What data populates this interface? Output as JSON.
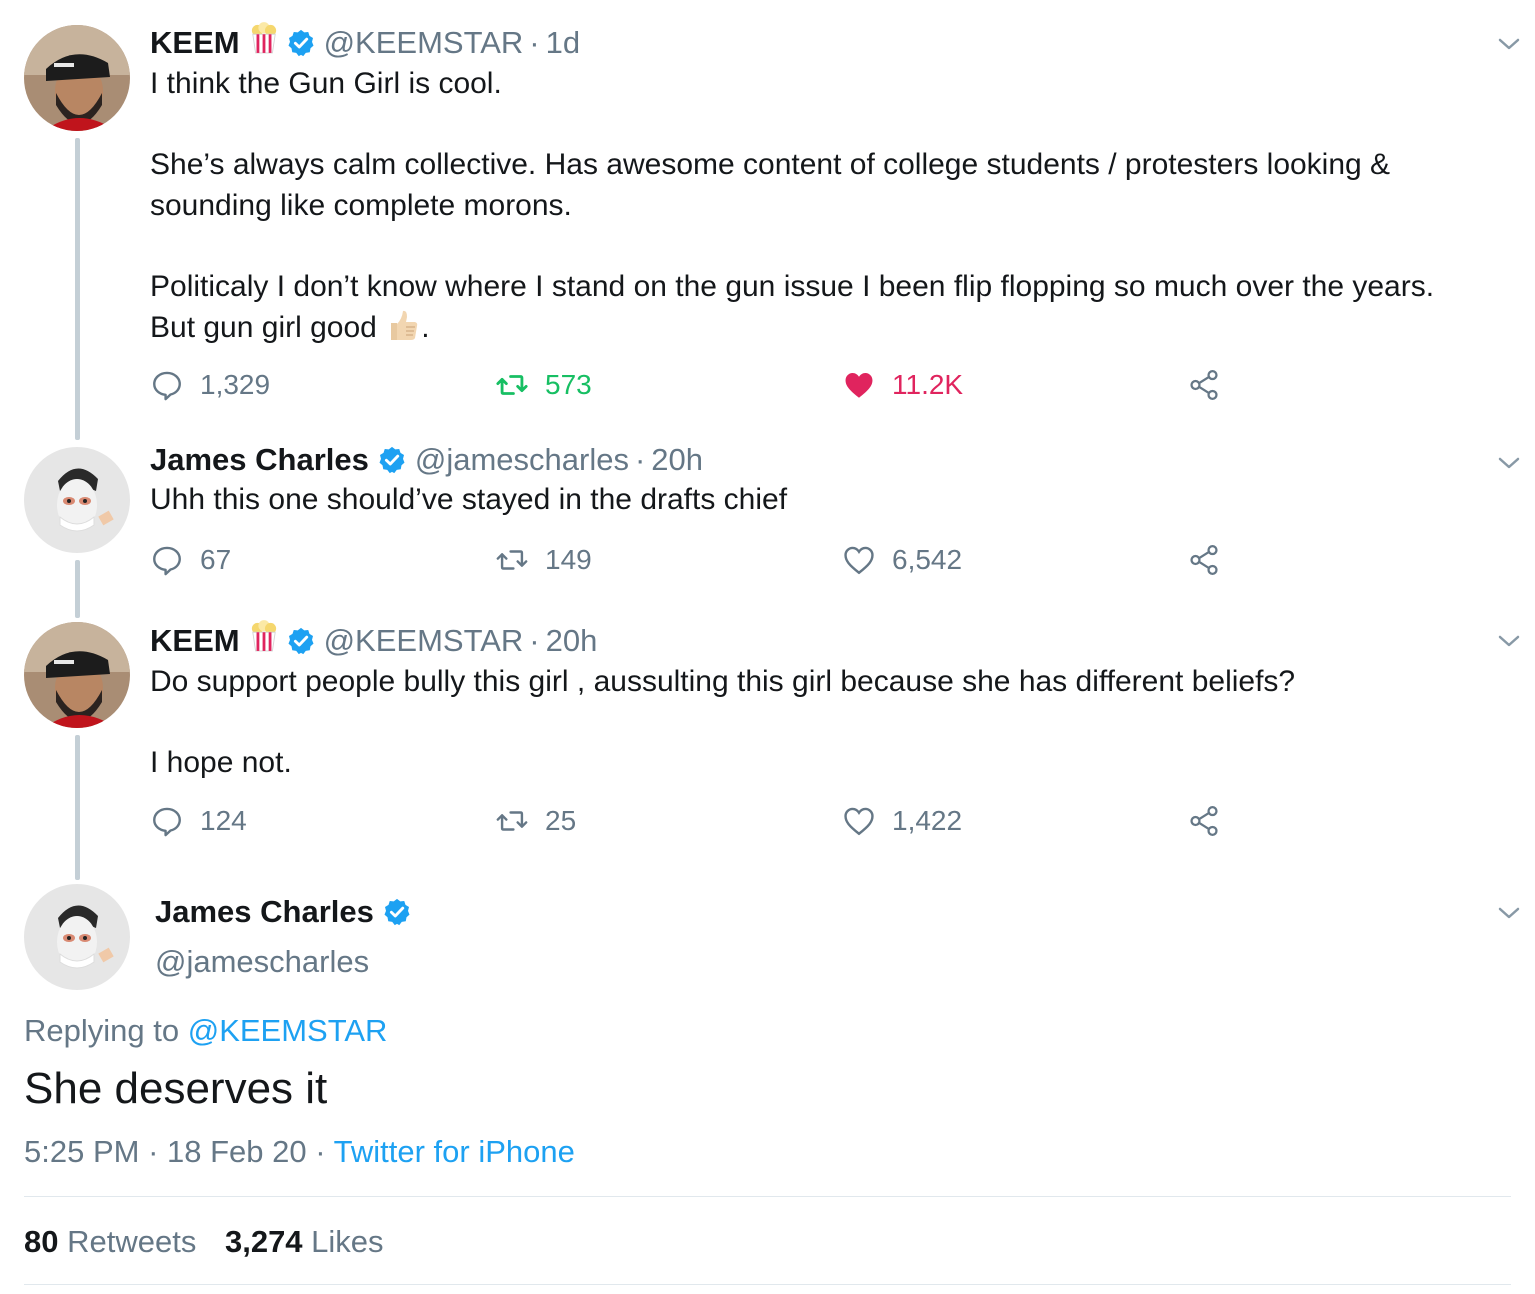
{
  "tweets": [
    {
      "name": "KEEM",
      "handle": "@KEEMSTAR",
      "time": "1d",
      "lines": [
        "I think the Gun Girl is cool.",
        "",
        "She’s always calm collective. Has awesome content of college students / protesters looking &",
        "sounding like complete morons.",
        "",
        "Politicaly I don’t know where I stand on the gun issue I been flip flopping so much over the years.",
        "But gun girl good"
      ],
      "replies": "1,329",
      "retweets": "573",
      "likes": "11.2K"
    },
    {
      "name": "James Charles",
      "handle": "@jamescharles",
      "time": "20h",
      "text": "Uhh this one should’ve stayed in the drafts chief",
      "replies": "67",
      "retweets": "149",
      "likes": "6,542"
    },
    {
      "name": "KEEM",
      "handle": "@KEEMSTAR",
      "time": "20h",
      "text": "Do support people bully this girl , aussulting this girl because she has different beliefs?\n\nI hope not.",
      "replies": "124",
      "retweets": "25",
      "likes": "1,422"
    }
  ],
  "main": {
    "name": "James Charles",
    "handle": "@jamescharles",
    "replying_prefix": "Replying to",
    "replying_to": "@KEEMSTAR",
    "text": "She deserves it",
    "time": "5:25 PM",
    "date": "18 Feb 20",
    "source": "Twitter for iPhone",
    "retweets_count": "80",
    "retweets_label": "Retweets",
    "likes_count": "3,274",
    "likes_label": "Likes"
  },
  "colors": {
    "accent": "#1da1f2",
    "retweet_active": "#17bf63",
    "like_active": "#e0245e",
    "muted": "#657786"
  },
  "icons": [
    "reply-icon",
    "retweet-icon",
    "like-icon",
    "share-icon",
    "verified-icon",
    "chevron-down-icon",
    "popcorn-emoji",
    "thumbs-up-emoji"
  ]
}
